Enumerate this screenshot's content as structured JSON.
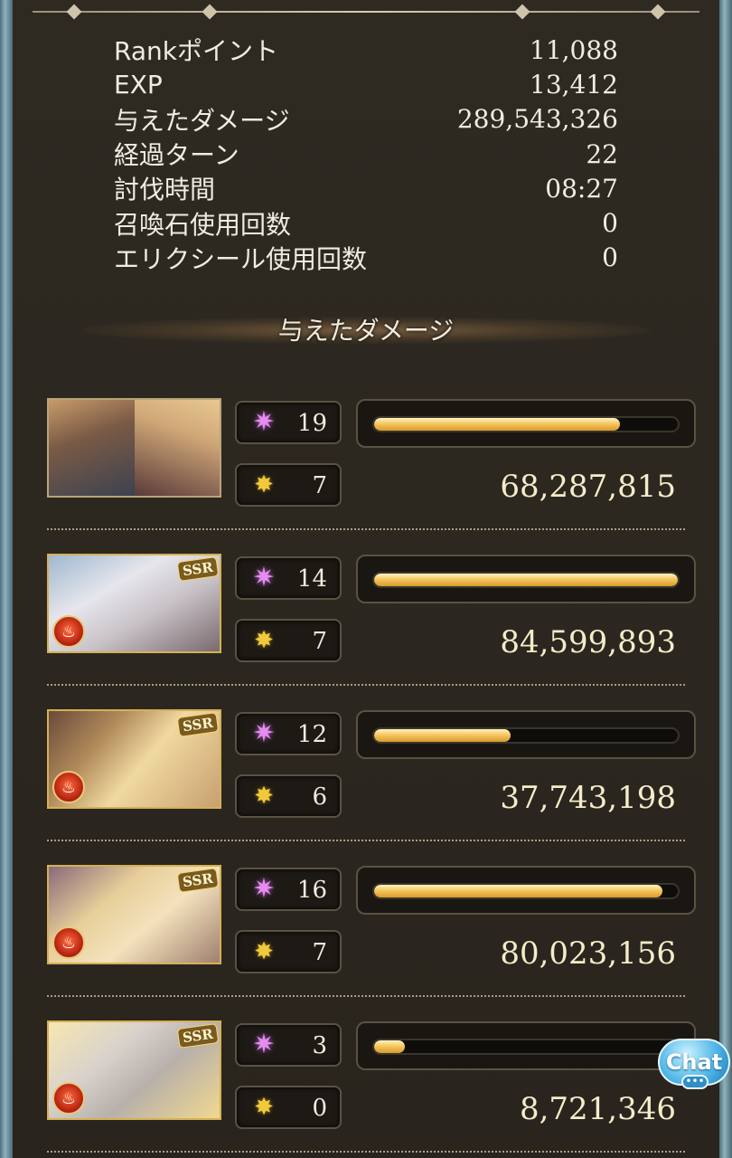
{
  "stats": [
    {
      "label": "Rankポイント",
      "value": "11,088"
    },
    {
      "label": "EXP",
      "value": "13,412"
    },
    {
      "label": "与えたダメージ",
      "value": "289,543,326"
    },
    {
      "label": "経過ターン",
      "value": "22"
    },
    {
      "label": "討伐時間",
      "value": "08:27"
    },
    {
      "label": "召喚石使用回数",
      "value": "0"
    },
    {
      "label": "エリクシール使用回数",
      "value": "0"
    }
  ],
  "section_title": "与えたダメージ",
  "characters": [
    {
      "portrait_icon": "player-duo-portrait",
      "ssr": false,
      "element_icon": "",
      "skills_used": "19",
      "ougi_count": "7",
      "damage": "68,287,815",
      "damage_fraction": 0.81
    },
    {
      "portrait_icon": "character-portrait",
      "ssr": true,
      "ssr_label": "SSR",
      "element_icon": "fire-element-icon",
      "skills_used": "14",
      "ougi_count": "7",
      "damage": "84,599,893",
      "damage_fraction": 1.0
    },
    {
      "portrait_icon": "character-portrait",
      "ssr": true,
      "ssr_label": "SSR",
      "element_icon": "fire-element-icon",
      "skills_used": "12",
      "ougi_count": "6",
      "damage": "37,743,198",
      "damage_fraction": 0.45
    },
    {
      "portrait_icon": "character-portrait",
      "ssr": true,
      "ssr_label": "SSR",
      "element_icon": "fire-element-icon",
      "skills_used": "16",
      "ougi_count": "7",
      "damage": "80,023,156",
      "damage_fraction": 0.95
    },
    {
      "portrait_icon": "character-portrait",
      "ssr": true,
      "ssr_label": "SSR",
      "element_icon": "fire-element-icon",
      "skills_used": "3",
      "ougi_count": "0",
      "damage": "8,721,346",
      "damage_fraction": 0.1
    }
  ],
  "icons": {
    "skill": "sparkle-icon",
    "ougi": "ougi-burst-icon",
    "element": "fire-element-icon"
  },
  "chat": {
    "label": "Chat",
    "dots": "•••"
  },
  "colors": {
    "background": "#2b271f",
    "bar_fill": "#f6c760",
    "text": "#f1ece0",
    "frame": "#8cb3bf"
  }
}
